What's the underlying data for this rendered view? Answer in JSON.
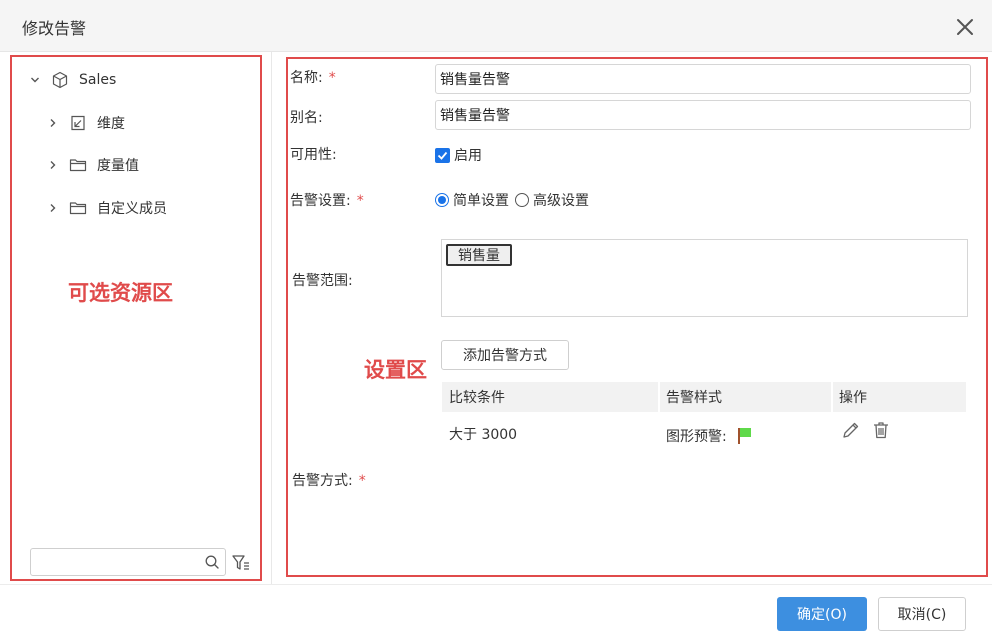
{
  "dialog": {
    "title": "修改告警"
  },
  "tree": {
    "root": {
      "label": "Sales"
    },
    "children": [
      {
        "label": "维度"
      },
      {
        "label": "度量值"
      },
      {
        "label": "自定义成员"
      }
    ]
  },
  "annotations": {
    "resource_area": "可选资源区",
    "settings_area": "设置区"
  },
  "search": {
    "placeholder": ""
  },
  "form": {
    "name_label": "名称:",
    "name_value": "销售量告警",
    "alias_label": "别名:",
    "alias_value": "销售量告警",
    "availability_label": "可用性:",
    "enabled_label": "启用",
    "enabled": true,
    "alert_setting_label": "告警设置:",
    "simple_label": "简单设置",
    "advanced_label": "高级设置",
    "selected_mode": "simple",
    "scope_label": "告警范围:",
    "scope_tag": "销售量",
    "add_method_label": "添加告警方式",
    "method_label": "告警方式:",
    "required_mark": "*"
  },
  "methods_table": {
    "headers": [
      "比较条件",
      "告警样式",
      "操作"
    ],
    "rows": [
      {
        "condition": "大于 3000",
        "style": "图形预警:"
      }
    ]
  },
  "footer": {
    "ok_label": "确定(O)",
    "cancel_label": "取消(C)"
  },
  "colors": {
    "accent": "#3d8fe0",
    "annotation": "#e04b4b",
    "flag": "#5fd94a"
  }
}
